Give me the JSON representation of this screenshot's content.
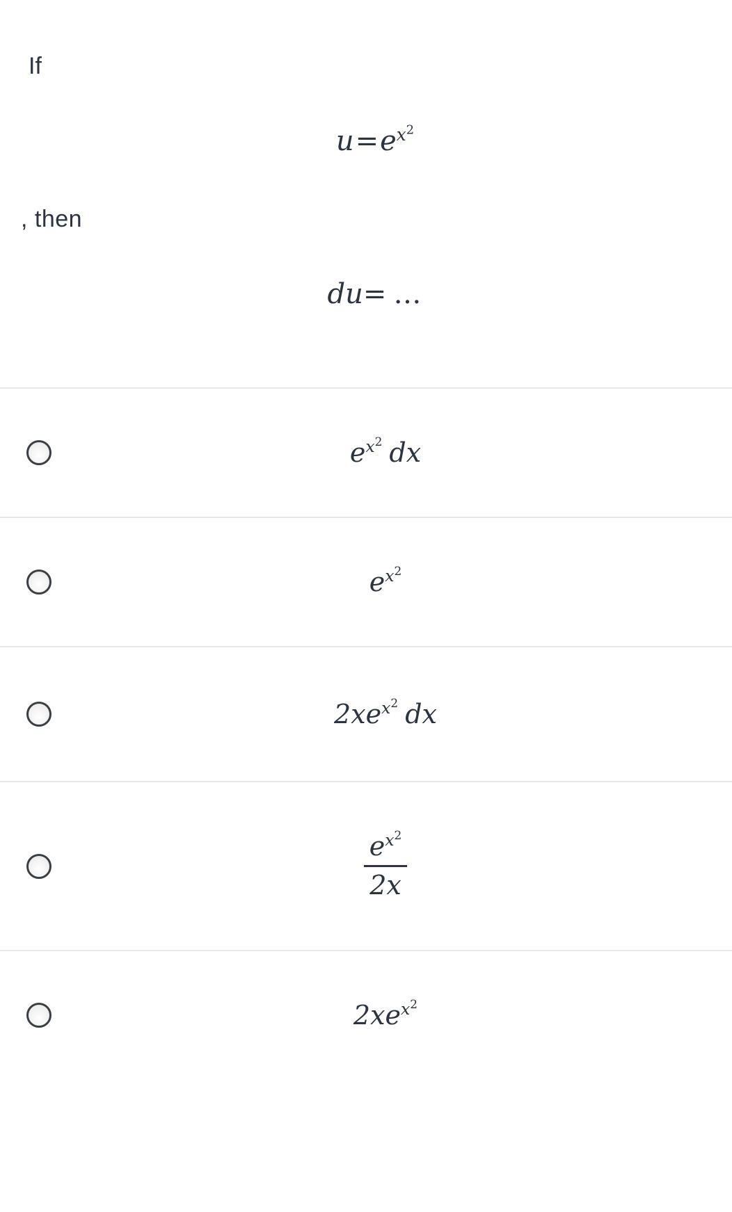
{
  "question": {
    "lead_word": "If",
    "connector": ", then",
    "given_formula": {
      "lhs": "u",
      "eq": "=",
      "base": "e",
      "exponent_var": "x",
      "exponent_pow": "2",
      "plain": "u = e^(x^2)"
    },
    "asked_formula": {
      "lhs": "du",
      "eq": "=",
      "ellipsis": "…",
      "plain": "du = ..."
    }
  },
  "options": [
    {
      "id": "option-a",
      "selected": false,
      "parts": {
        "coefficient": "",
        "base": "e",
        "exp_var": "x",
        "exp_pow": "2",
        "differential": "dx"
      },
      "plain": "e^(x^2) dx"
    },
    {
      "id": "option-b",
      "selected": false,
      "parts": {
        "coefficient": "",
        "base": "e",
        "exp_var": "x",
        "exp_pow": "2",
        "differential": ""
      },
      "plain": "e^(x^2)"
    },
    {
      "id": "option-c",
      "selected": false,
      "parts": {
        "coefficient": "2x",
        "base": "e",
        "exp_var": "x",
        "exp_pow": "2",
        "differential": "dx"
      },
      "plain": "2xe^(x^2) dx"
    },
    {
      "id": "option-d",
      "selected": false,
      "parts": {
        "numerator_base": "e",
        "numerator_exp_var": "x",
        "numerator_exp_pow": "2",
        "denominator": "2x"
      },
      "plain": "e^(x^2) / 2x"
    },
    {
      "id": "option-e",
      "selected": false,
      "parts": {
        "coefficient": "2x",
        "base": "e",
        "exp_var": "x",
        "exp_pow": "2",
        "differential": ""
      },
      "plain": "2xe^(x^2)"
    }
  ],
  "style": {
    "text_color": "#2b3440",
    "divider_color": "#e8e8e8",
    "background": "#ffffff",
    "radio_border": "#3a3f45"
  }
}
